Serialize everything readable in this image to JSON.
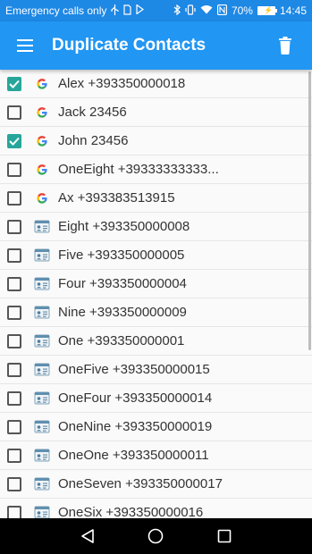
{
  "status_bar": {
    "left_text": "Emergency calls only",
    "battery": "70%",
    "time": "14:45"
  },
  "app_bar": {
    "title": "Duplicate Contacts"
  },
  "contacts": [
    {
      "label": "Alex +393350000018",
      "checked": true,
      "source": "google-icon"
    },
    {
      "label": "Jack 23456",
      "checked": false,
      "source": "google-icon"
    },
    {
      "label": "John 23456",
      "checked": true,
      "source": "google-icon"
    },
    {
      "label": "OneEight +39333333333...",
      "checked": false,
      "source": "google-icon"
    },
    {
      "label": "Ax +393383513915",
      "checked": false,
      "source": "google-icon"
    },
    {
      "label": "Eight +393350000008",
      "checked": false,
      "source": "contact-card-icon"
    },
    {
      "label": "Five +393350000005",
      "checked": false,
      "source": "contact-card-icon"
    },
    {
      "label": "Four +393350000004",
      "checked": false,
      "source": "contact-card-icon"
    },
    {
      "label": "Nine +393350000009",
      "checked": false,
      "source": "contact-card-icon"
    },
    {
      "label": "One +393350000001",
      "checked": false,
      "source": "contact-card-icon"
    },
    {
      "label": "OneFive +393350000015",
      "checked": false,
      "source": "contact-card-icon"
    },
    {
      "label": "OneFour +393350000014",
      "checked": false,
      "source": "contact-card-icon"
    },
    {
      "label": "OneNine +393350000019",
      "checked": false,
      "source": "contact-card-icon"
    },
    {
      "label": "OneOne +393350000011",
      "checked": false,
      "source": "contact-card-icon"
    },
    {
      "label": "OneSeven +393350000017",
      "checked": false,
      "source": "contact-card-icon"
    },
    {
      "label": "OneSix +393350000016",
      "checked": false,
      "source": "contact-card-icon"
    }
  ],
  "colors": {
    "app_bar": "#2196f3",
    "status_bar": "#1e88e5",
    "checkbox_checked": "#26a69a"
  }
}
